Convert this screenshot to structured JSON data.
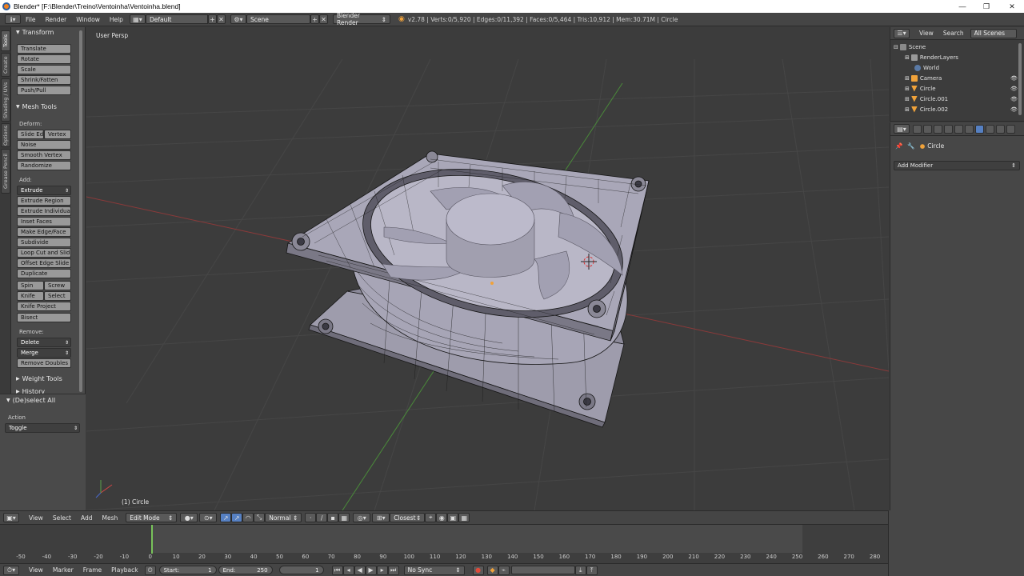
{
  "window": {
    "title": "Blender* [F:\\Blender\\Treino\\Ventoinha\\Ventoinha.blend]",
    "controls": {
      "minimize": "—",
      "maximize": "❐",
      "close": "✕"
    }
  },
  "info_header": {
    "menus": [
      "File",
      "Render",
      "Window",
      "Help"
    ],
    "screen_layout": "Default",
    "scene": "Scene",
    "render_engine": "Blender Render",
    "stats": "v2.78 | Verts:0/5,920 | Edges:0/11,392 | Faces:0/5,464 | Tris:10,912 | Mem:30.71M | Circle"
  },
  "side_tabs": [
    "Tools",
    "Create",
    "Shading / UVs",
    "Options",
    "Grease Pencil"
  ],
  "tool_shelf": {
    "transform": {
      "title": "Transform",
      "buttons": [
        "Translate",
        "Rotate",
        "Scale",
        "Shrink/Fatten",
        "Push/Pull"
      ]
    },
    "mesh_tools": {
      "title": "Mesh Tools",
      "deform_label": "Deform:",
      "slide_edge": "Slide Ed",
      "vertex": "Vertex",
      "noise": "Noise",
      "smooth_vertex": "Smooth Vertex",
      "randomize": "Randomize",
      "add_label": "Add:",
      "extrude": "Extrude",
      "add_buttons": [
        "Extrude Region",
        "Extrude Individual",
        "Inset Faces",
        "Make Edge/Face",
        "Subdivide",
        "Loop Cut and Slide",
        "Offset Edge Slide",
        "Duplicate"
      ],
      "spin": "Spin",
      "screw": "Screw",
      "knife": "Knife",
      "select": "Select",
      "knife_project": "Knife Project",
      "bisect": "Bisect",
      "remove_label": "Remove:",
      "delete": "Delete",
      "merge": "Merge",
      "remove_doubles": "Remove Doubles"
    },
    "weight_tools": "Weight Tools",
    "history": "History",
    "operator": {
      "title": "(De)select All",
      "action_label": "Action",
      "action_value": "Toggle"
    }
  },
  "viewport": {
    "view_label": "User Persp",
    "object_label": "(1) Circle"
  },
  "outliner": {
    "view_menu": "View",
    "search_menu": "Search",
    "filter": "All Scenes",
    "items": [
      "Scene",
      "RenderLayers",
      "World",
      "Camera",
      "Circle",
      "Circle.001",
      "Circle.002"
    ]
  },
  "properties": {
    "context_object": "Circle",
    "add_modifier": "Add Modifier"
  },
  "view3d_header": {
    "menus": [
      "View",
      "Select",
      "Add",
      "Mesh"
    ],
    "mode": "Edit Mode",
    "orientation": "Normal",
    "snap_target": "Closest"
  },
  "timeline": {
    "ticks": [
      "-50",
      "-40",
      "-30",
      "-20",
      "-10",
      "0",
      "10",
      "20",
      "30",
      "40",
      "50",
      "60",
      "70",
      "80",
      "90",
      "100",
      "110",
      "120",
      "130",
      "140",
      "150",
      "160",
      "170",
      "180",
      "190",
      "200",
      "210",
      "220",
      "230",
      "240",
      "250",
      "260",
      "270",
      "280"
    ],
    "menus": [
      "View",
      "Marker",
      "Frame",
      "Playback"
    ],
    "start_label": "Start:",
    "start_value": "1",
    "end_label": "End:",
    "end_value": "250",
    "current_frame": "1",
    "sync": "No Sync"
  },
  "colors": {
    "accent_blue": "#5680c2",
    "selected_orange": "#f0a23a",
    "frame_marker_green": "#78c25a",
    "x_axis_red": "#8a3a3a",
    "y_axis_green": "#4a8a3a"
  }
}
